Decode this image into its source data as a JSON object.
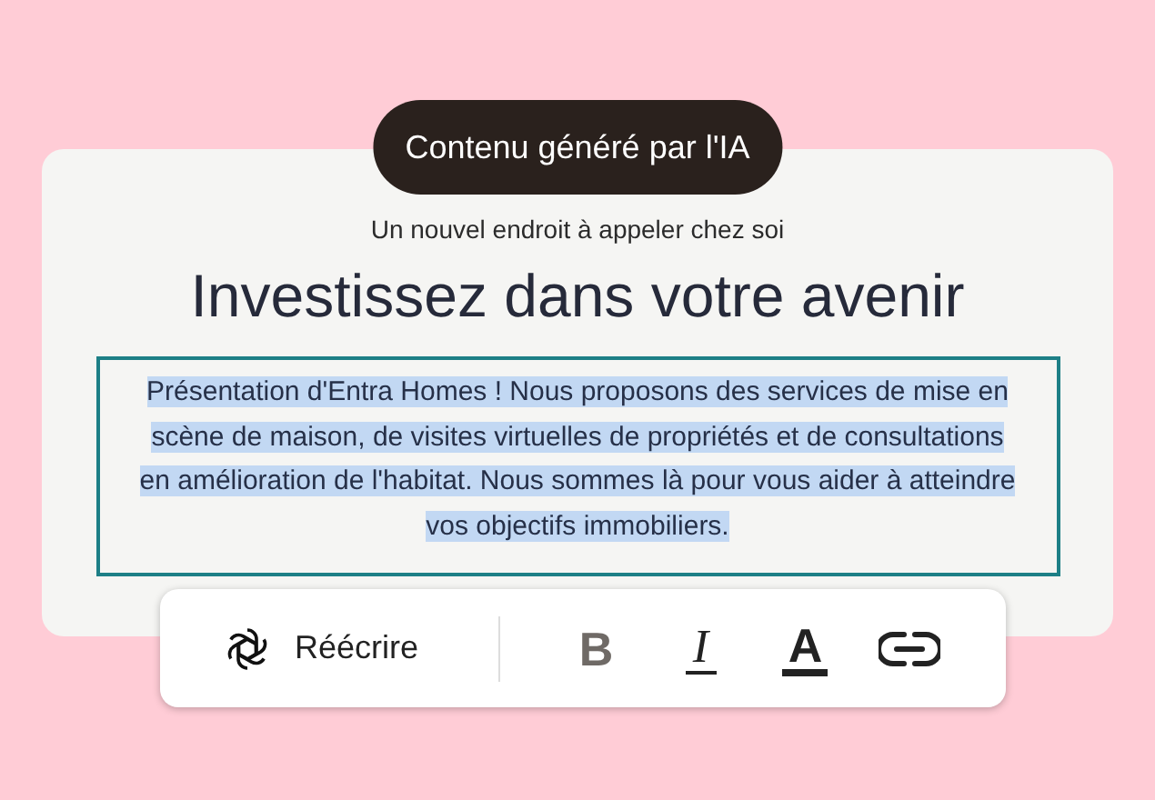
{
  "badge": "Contenu généré par l'IA",
  "subtitle": "Un nouvel endroit à appeler chez soi",
  "heading": "Investissez dans votre avenir",
  "paragraph": {
    "text": "Présentation d'Entra Homes ! Nous proposons des services de mise en scène de maison, de visites virtuelles de propriétés et de consultations en amélioration de l'habitat. Nous sommes là pour vous aider à atteindre vos objectifs immobiliers.",
    "selected": true
  },
  "toolbar": {
    "rewrite": "Réécrire",
    "format_buttons": [
      {
        "kind": "bold",
        "label": "B"
      },
      {
        "kind": "italic",
        "label": "I"
      },
      {
        "kind": "color",
        "label": "A"
      },
      {
        "kind": "link"
      }
    ]
  }
}
